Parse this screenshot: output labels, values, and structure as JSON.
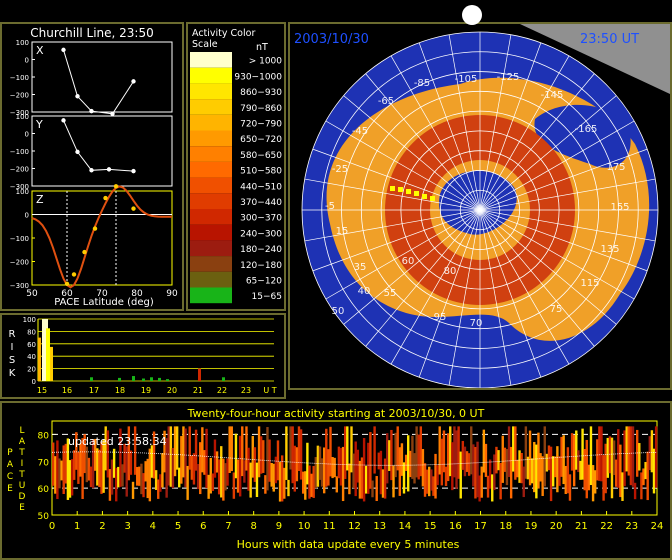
{
  "churchill": {
    "title": "Churchill Line, 23:50",
    "xlabel": "PACE Latitude (deg)",
    "xticks": [
      "50",
      "60",
      "70",
      "80",
      "90"
    ],
    "subplots": [
      {
        "label": "X",
        "yticks": [
          "100",
          "0",
          "−100",
          "−200",
          "−300"
        ],
        "points": [
          [
            59,
            55
          ],
          [
            63,
            -210
          ],
          [
            67,
            -295
          ],
          [
            73,
            -310
          ],
          [
            79,
            -125
          ]
        ]
      },
      {
        "label": "Y",
        "yticks": [
          "100",
          "0",
          "−100",
          "−200",
          "−300"
        ],
        "points": [
          [
            59,
            75
          ],
          [
            63,
            -105
          ],
          [
            67,
            -210
          ],
          [
            72,
            -205
          ],
          [
            79,
            -215
          ]
        ]
      },
      {
        "label": "Z",
        "yticks": [
          "100",
          "0",
          "−100",
          "−200",
          "−300"
        ],
        "points": [
          [
            60,
            -295
          ],
          [
            62,
            -255
          ],
          [
            65,
            -160
          ],
          [
            68,
            -60
          ],
          [
            71,
            70
          ],
          [
            74,
            120
          ],
          [
            79,
            25
          ]
        ]
      }
    ]
  },
  "color_scale": {
    "title_line1": "Activity Color",
    "title_line2": "Scale",
    "unit": "nT",
    "entries": [
      {
        "label": "> 1000",
        "color": "#ffffcc"
      },
      {
        "label": "930−1000",
        "color": "#ffff00"
      },
      {
        "label": "860−930",
        "color": "#ffe600"
      },
      {
        "label": "790−860",
        "color": "#ffcc00"
      },
      {
        "label": "720−790",
        "color": "#ffb400"
      },
      {
        "label": "650−720",
        "color": "#ff9a00"
      },
      {
        "label": "580−650",
        "color": "#ff8000"
      },
      {
        "label": "510−580",
        "color": "#ff6a00"
      },
      {
        "label": "440−510",
        "color": "#f05000"
      },
      {
        "label": "370−440",
        "color": "#e03c00"
      },
      {
        "label": "300−370",
        "color": "#d02800"
      },
      {
        "label": "240−300",
        "color": "#b81400"
      },
      {
        "label": "180−240",
        "color": "#9c1c10"
      },
      {
        "label": "120−180",
        "color": "#8a4010"
      },
      {
        "label": "65−120",
        "color": "#6b6010"
      },
      {
        "label": "15−65",
        "color": "#18b418"
      }
    ]
  },
  "risk": {
    "ylabel_letters": [
      "R",
      "I",
      "S",
      "K"
    ],
    "yticks": [
      "100",
      "80",
      "60",
      "40",
      "20",
      "0"
    ],
    "xticks": [
      "15",
      "16",
      "17",
      "18",
      "19",
      "20",
      "21",
      "22",
      "23",
      "U T"
    ]
  },
  "map": {
    "date": "2003/10/30",
    "time": "23:50 UT",
    "lon_labels": [
      "-105",
      "-85",
      "-125",
      "-65",
      "-145",
      "-45",
      "-165",
      "-25",
      "175",
      "-5",
      "155",
      "15",
      "135",
      "35",
      "115",
      "55",
      "75",
      "95",
      "40",
      "50",
      "60",
      "70",
      "80"
    ],
    "colors": {
      "ocean": "#1e32b4",
      "land": "#f0a028",
      "oval": "#d04010",
      "space": "#000000",
      "grid": "#ffffff"
    }
  },
  "activity": {
    "title": "Twenty-four-hour activity starting at 2003/10/30, 0 UT",
    "updated": "updated 23:58:34",
    "ylabel_top": [
      "L",
      "A",
      "T",
      "I",
      "T",
      "U",
      "D",
      "E"
    ],
    "ylabel_side": [
      "P",
      "A",
      "C",
      "E"
    ],
    "yticks": [
      "80",
      "70",
      "60",
      "50"
    ],
    "xticks": [
      "0",
      "1",
      "2",
      "3",
      "4",
      "5",
      "6",
      "7",
      "8",
      "9",
      "10",
      "11",
      "12",
      "13",
      "14",
      "15",
      "16",
      "17",
      "18",
      "19",
      "20",
      "21",
      "22",
      "23",
      "24"
    ],
    "xlabel": "Hours with data update every 5  minutes"
  }
}
